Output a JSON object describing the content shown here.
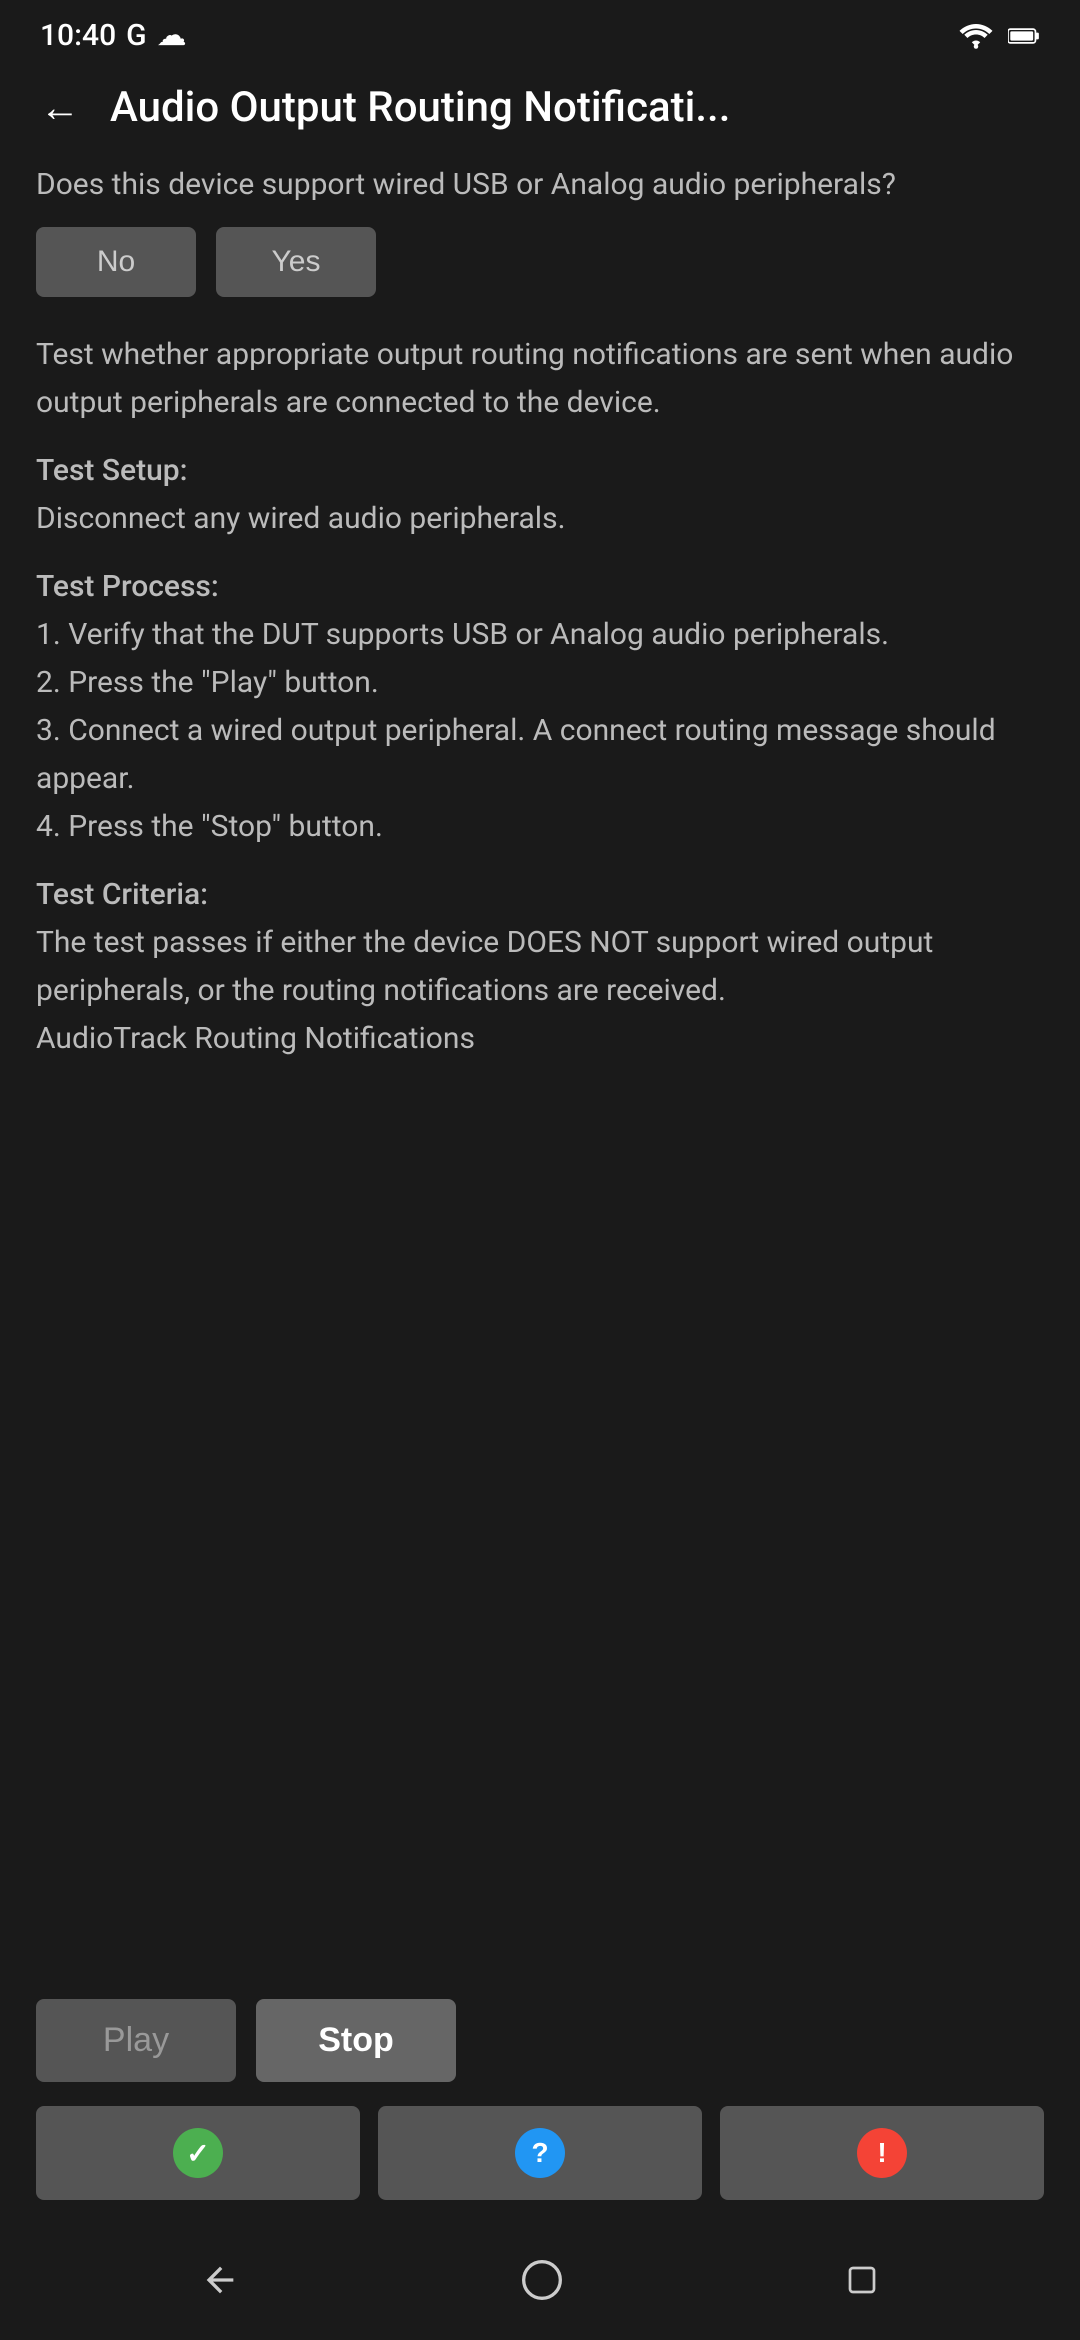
{
  "statusBar": {
    "time": "10:40",
    "googleLabel": "G",
    "cloudLabel": "☁"
  },
  "header": {
    "backLabel": "←",
    "title": "Audio Output Routing Notificati..."
  },
  "usbQuestion": {
    "questionText": "Does this device support wired USB or Analog audio peripherals?",
    "noLabel": "No",
    "yesLabel": "Yes"
  },
  "description": {
    "testDescription": "Test whether appropriate output routing notifications are sent when audio output peripherals are connected to the device.",
    "testSetupHeading": "Test Setup:",
    "testSetupText": "Disconnect any wired audio peripherals.",
    "testProcessHeading": "Test Process:",
    "testProcessStep1": "1. Verify that the DUT supports USB or Analog audio peripherals.",
    "testProcessStep2": "2. Press the \"Play\" button.",
    "testProcessStep3": "3. Connect a wired output peripheral. A connect routing message should appear.",
    "testProcessStep4": "4. Press the \"Stop\" button.",
    "testCriteriaHeading": "Test Criteria:",
    "testCriteriaText": "The test passes if either the device DOES NOT support wired output peripherals, or the routing notifications are received.",
    "audioTrackLabel": "AudioTrack Routing Notifications"
  },
  "controls": {
    "playLabel": "Play",
    "stopLabel": "Stop",
    "passIcon": "✓",
    "infoIcon": "?",
    "failIcon": "!"
  }
}
